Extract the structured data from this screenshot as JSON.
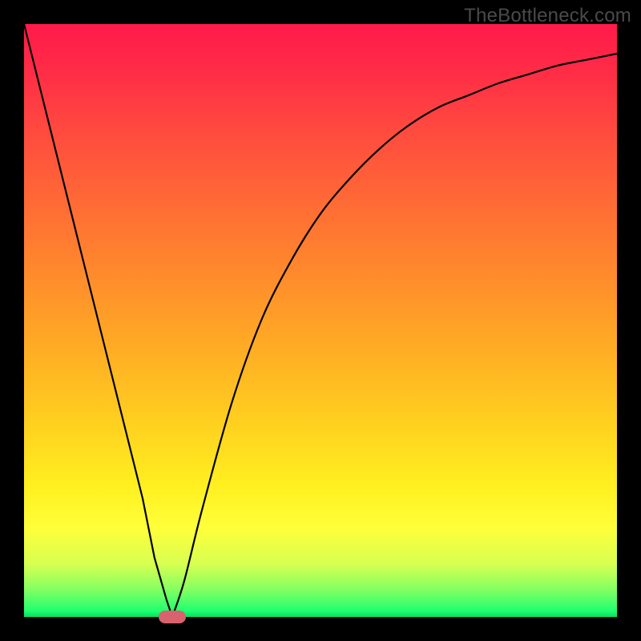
{
  "watermark": "TheBottleneck.com",
  "colors": {
    "frame": "#000000",
    "curve_stroke": "#000000",
    "marker_fill": "#d9626f",
    "watermark_text": "#4a4a4a"
  },
  "chart_data": {
    "type": "line",
    "title": "",
    "xlabel": "",
    "ylabel": "",
    "xlim": [
      0,
      100
    ],
    "ylim": [
      0,
      100
    ],
    "grid": false,
    "series": [
      {
        "name": "bottleneck-curve",
        "x": [
          0,
          5,
          10,
          15,
          20,
          22,
          24,
          25,
          27,
          30,
          35,
          40,
          45,
          50,
          55,
          60,
          65,
          70,
          75,
          80,
          85,
          90,
          95,
          100
        ],
        "y": [
          100,
          80,
          60,
          40,
          20,
          10,
          3,
          0,
          6,
          18,
          36,
          50,
          60,
          68,
          74,
          79,
          83,
          86,
          88,
          90,
          91.5,
          93,
          94,
          95
        ]
      }
    ],
    "marker": {
      "x": 25,
      "y": 0
    },
    "gradient_stops": [
      {
        "pos": 0,
        "color": "#ff1a4a"
      },
      {
        "pos": 50,
        "color": "#ffd21f"
      },
      {
        "pos": 85,
        "color": "#ffff3a"
      },
      {
        "pos": 100,
        "color": "#00e060"
      }
    ]
  }
}
